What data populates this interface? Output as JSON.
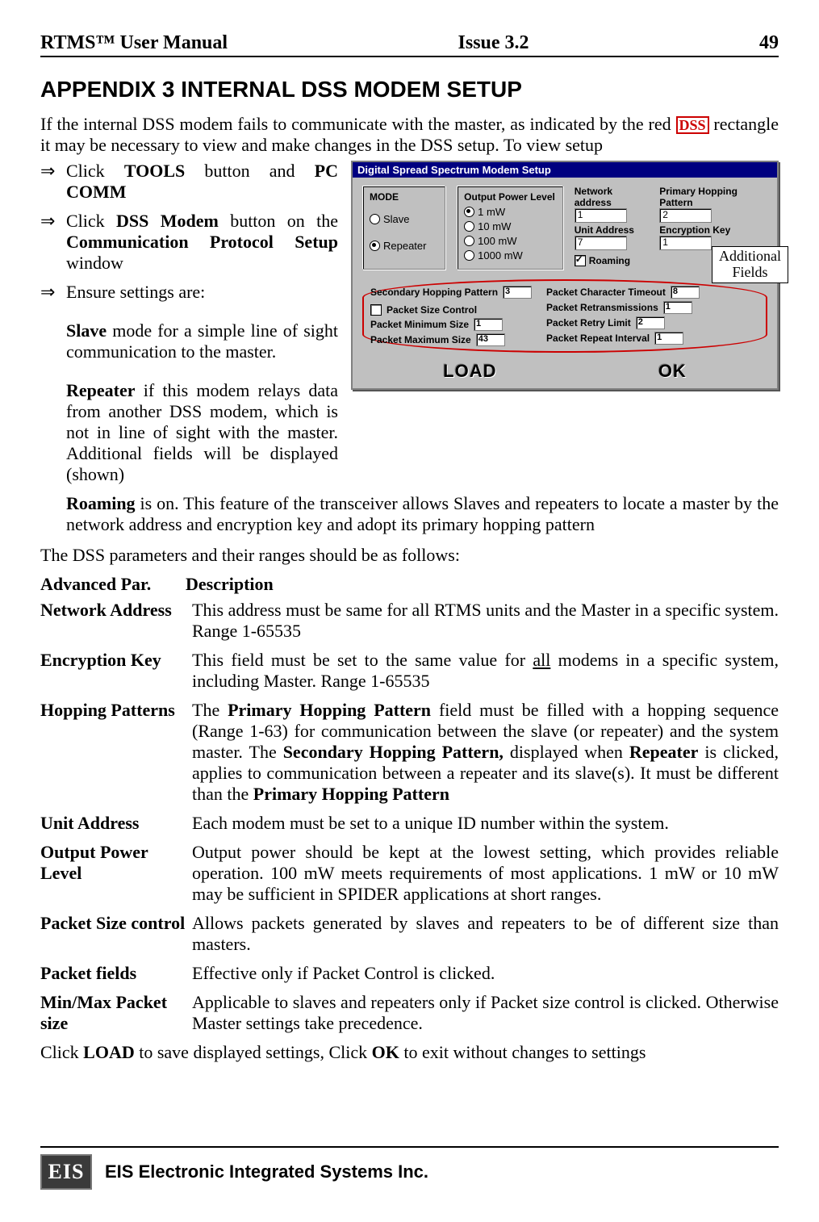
{
  "header": {
    "left": "RTMS™ User Manual",
    "center": "Issue 3.2",
    "right": "49"
  },
  "title": "APPENDIX 3     INTERNAL DSS MODEM SETUP",
  "intro_prefix": "If the internal DSS modem fails to communicate with the master, as indicated by the red ",
  "dss_box": "DSS",
  "intro_suffix": " rectangle it may be necessary to view and make changes in the DSS setup. To view setup",
  "bullets": {
    "b1_pre": "Click ",
    "b1_b1": "TOOLS",
    "b1_mid": " button and ",
    "b1_b2": "PC COMM",
    "b2_pre": "Click ",
    "b2_b1": "DSS Modem",
    "b2_mid": " button on the ",
    "b2_b2": "Communication Protocol Setup",
    "b2_end": " window",
    "b3": "Ensure settings are:"
  },
  "indent1": {
    "t1b": "Slave",
    "t1": " mode for a simple line of sight communication to the master."
  },
  "indent2": {
    "t1b": "Repeater",
    "t1": " if this modem relays data from another DSS modem, which is not in line of sight with the master. Additional fields will be displayed (shown)"
  },
  "roaming": {
    "t1b": "Roaming",
    "t1": " is on. This feature of the transceiver allows Slaves and repeaters to locate a master by the network address and encryption key and adopt its primary hopping pattern"
  },
  "params_intro": "The DSS parameters and their ranges should be as follows:",
  "params_header": {
    "c1": "Advanced Par.",
    "c2": "Description"
  },
  "params": [
    {
      "name": "Network Address",
      "desc_plain": "This address must be same for all RTMS units and the Master in a specific system. Range 1-65535"
    },
    {
      "name": "Encryption Key",
      "desc_pre": "This field must be set to the same value for ",
      "desc_u": "all",
      "desc_post": " modems in a specific system, including Master. Range 1-65535"
    },
    {
      "name": "Hopping Patterns",
      "desc_p1": "The ",
      "desc_b1": "Primary Hopping Pattern",
      "desc_p2": " field must be filled with a hopping sequence (Range 1-63) for communication between the slave (or repeater) and the system master.   The ",
      "desc_b2": "Secondary Hopping Pattern,",
      "desc_p3": " displayed when ",
      "desc_b3": "Repeater",
      "desc_p4": " is clicked, applies to communication between a repeater and its slave(s). It must be different than the ",
      "desc_b4": "Primary Hopping Pattern"
    },
    {
      "name": "Unit Address",
      "desc_plain": "Each modem must be set to a unique ID number within the system."
    },
    {
      "name": "Output Power Level",
      "desc_plain": "Output power should be kept at the lowest setting, which provides reliable operation. 100 mW meets requirements of most applications. 1 mW or 10 mW may be sufficient in SPIDER applications at short ranges."
    },
    {
      "name": "Packet Size control",
      "desc_plain": "Allows packets generated by slaves and repeaters to be of different size than masters."
    },
    {
      "name": "Packet fields",
      "desc_plain": "Effective only if Packet Control is clicked."
    },
    {
      "name": "Min/Max Packet size",
      "desc_plain": "Applicable to slaves and repeaters only if Packet size control is clicked.  Otherwise Master settings take precedence."
    }
  ],
  "closing": {
    "p1": "Click  ",
    "b1": "LOAD",
    "p2": " to save displayed settings,  Click ",
    "b2": "OK",
    "p3": " to exit without changes to settings"
  },
  "dialog": {
    "title": "Digital Spread Spectrum Modem Setup",
    "mode_label": "MODE",
    "mode_slave": "Slave",
    "mode_repeater": "Repeater",
    "power_label": "Output Power Level",
    "power_opts": [
      "1 mW",
      "10 mW",
      "100 mW",
      "1000 mW"
    ],
    "net_addr_label": "Network address",
    "net_addr_val": "1",
    "unit_addr_label": "Unit Address",
    "unit_addr_val": "7",
    "php_label": "Primary Hopping Pattern",
    "php_val": "2",
    "enc_label": "Encryption Key",
    "enc_val": "1",
    "roaming_label": "Roaming",
    "shp_label": "Secondary Hopping Pattern",
    "shp_val": "3",
    "psc_label": "Packet Size Control",
    "pmin_label": "Packet Minimum Size",
    "pmin_val": "1",
    "pmax_label": "Packet Maximum Size",
    "pmax_val": "43",
    "pct_label": "Packet Character Timeout",
    "pct_val": "8",
    "pret_label": "Packet Retransmissions",
    "pret_val": "1",
    "prl_label": "Packet Retry Limit",
    "prl_val": "2",
    "pri_label": "Packet Repeat Interval",
    "pri_val": "1",
    "load_btn": "LOAD",
    "ok_btn": "OK"
  },
  "callout": "Additional\nFields",
  "footer": {
    "logo": "EIS",
    "text": "EIS Electronic Integrated Systems Inc."
  }
}
